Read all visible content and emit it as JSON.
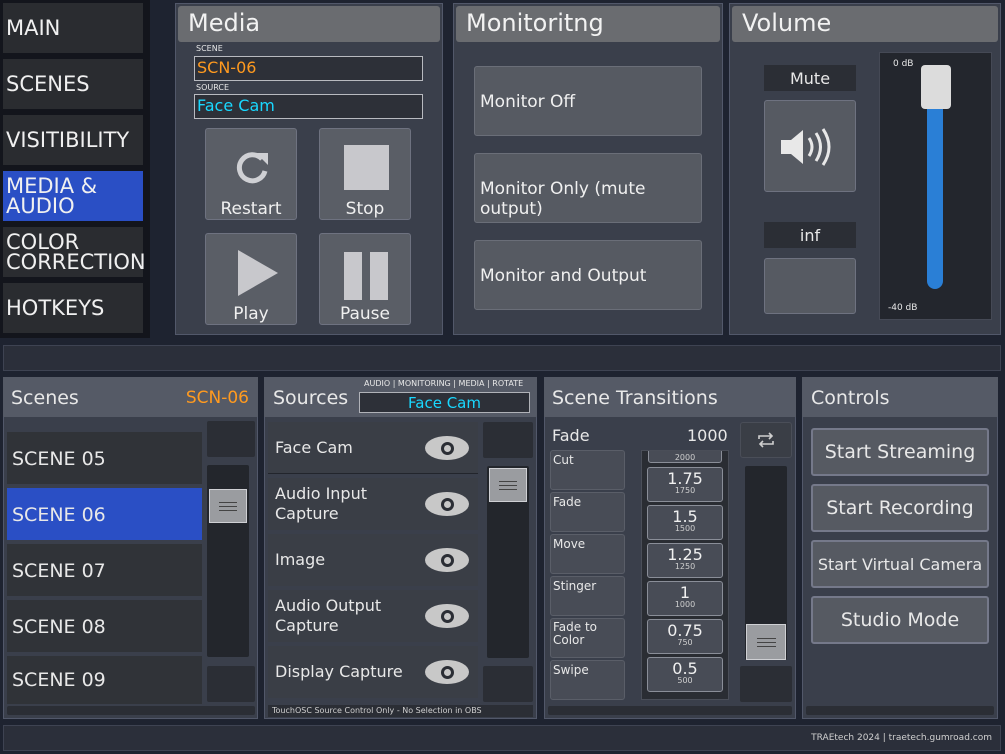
{
  "nav": {
    "items": [
      {
        "label": "MAIN"
      },
      {
        "label": "SCENES"
      },
      {
        "label": "VISITIBILITY"
      },
      {
        "label": "MEDIA & AUDIO"
      },
      {
        "label": "COLOR CORRECTION"
      },
      {
        "label": "HOTKEYS"
      }
    ],
    "active_index": 3
  },
  "media": {
    "title": "Media",
    "scene_label": "SCENE",
    "scene_value": "SCN-06",
    "source_label": "SOURCE",
    "source_value": "Face Cam",
    "buttons": {
      "restart": "Restart",
      "stop": "Stop",
      "play": "Play",
      "pause": "Pause"
    }
  },
  "monitoring": {
    "title": "Monitoritng",
    "options": [
      "Monitor Off",
      "Monitor Only (mute output)",
      "Monitor and Output"
    ]
  },
  "volume": {
    "title": "Volume",
    "mute_label": "Mute",
    "level_label": "inf",
    "top_label": "0 dB",
    "bottom_label": "-40 dB",
    "level_fraction": 1.0
  },
  "scenes": {
    "title": "Scenes",
    "current": "SCN-06",
    "items": [
      "SCENE 05",
      "SCENE 06",
      "SCENE 07",
      "SCENE 08",
      "SCENE 09"
    ],
    "selected_index": 1
  },
  "sources": {
    "title": "Sources",
    "mode_label": "AUDIO | MONITORING | MEDIA | ROTATE",
    "selected": "Face Cam",
    "items": [
      "Face Cam",
      "Audio Input Capture",
      "Image",
      "Audio Output Capture",
      "Display Capture"
    ],
    "footer": "TouchOSC Source Control Only - No Selection in OBS"
  },
  "transitions": {
    "title": "Scene Transitions",
    "current_name": "Fade",
    "current_duration": "1000",
    "types": [
      "Cut",
      "Fade",
      "Move",
      "Stinger",
      "Fade to Color",
      "Swipe"
    ],
    "durations": [
      {
        "mult": "1.75",
        "ms": "1750"
      },
      {
        "mult": "1.5",
        "ms": "1500"
      },
      {
        "mult": "1.25",
        "ms": "1250"
      },
      {
        "mult": "1",
        "ms": "1000"
      },
      {
        "mult": "0.75",
        "ms": "750"
      },
      {
        "mult": "0.5",
        "ms": "500"
      }
    ],
    "partial_top_ms": "2000"
  },
  "controls": {
    "title": "Controls",
    "buttons": [
      "Start Streaming",
      "Start Recording",
      "Start Virtual Camera",
      "Studio Mode"
    ]
  },
  "footer": {
    "credit": "TRAEtech 2024 | traetech.gumroad.com"
  },
  "colors": {
    "accent_blue": "#2a4fc5",
    "scene_orange": "#ff9a1f",
    "source_cyan": "#19d8ff",
    "volume_blue": "#2a7fd6"
  }
}
